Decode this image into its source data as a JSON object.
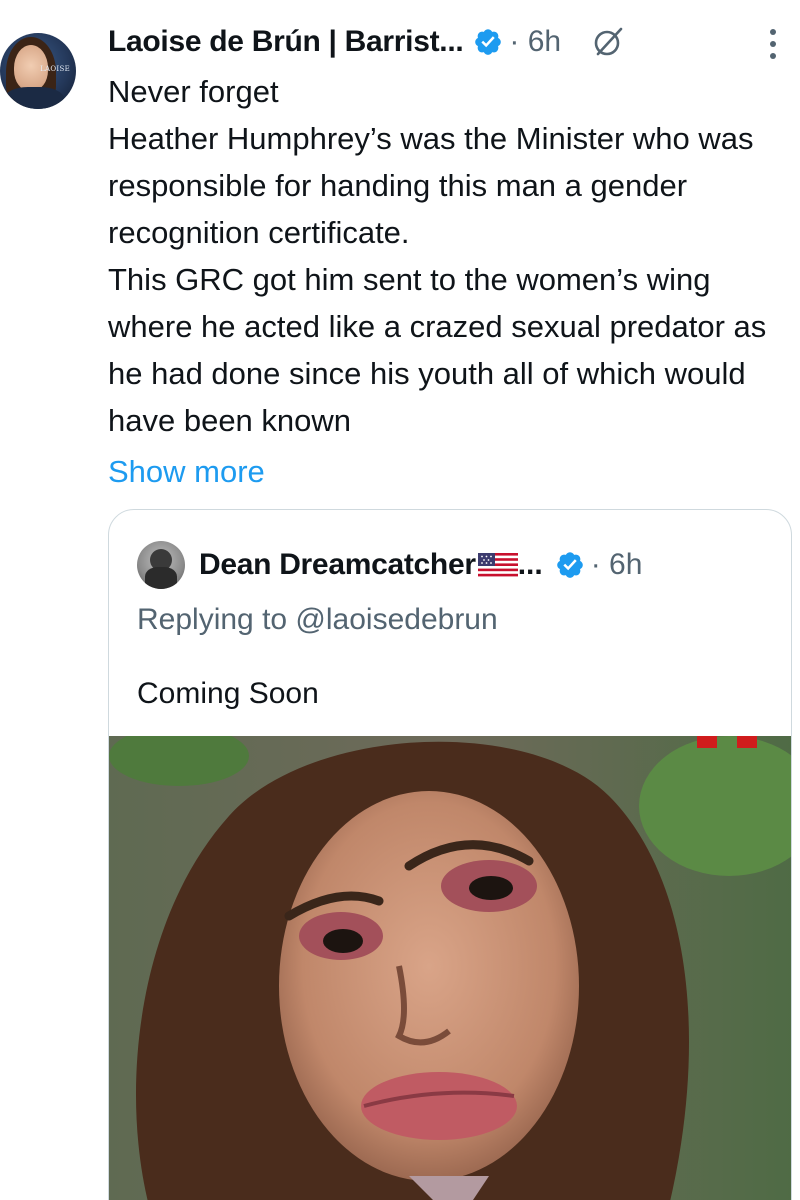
{
  "tweet": {
    "author_name": "Laoise de Brún | Barrist...",
    "time": "· 6h",
    "avatar_text": "LAOISE",
    "text": "Never forget\nHeather Humphrey’s was the Minister who was responsible for handing this man a gender recognition certificate.\n This GRC got him sent to the women’s wing where he acted like a crazed sexual predator as he had done since his youth all of which would have been known",
    "show_more": "Show more"
  },
  "quote": {
    "author_name": "Dean Dreamcatcher",
    "ellipsis": "...",
    "time": "· 6h",
    "replying_to": "Replying to @laoisedebrun",
    "text": "Coming Soon"
  },
  "icons": {
    "verified": "verified-check-icon",
    "grok": "grok-icon",
    "more": "more-vertical-icon",
    "flag": "us-flag-icon"
  },
  "colors": {
    "link": "#1d9bf0",
    "secondary_text": "#536471",
    "verified": "#1d9bf0",
    "border": "#cfd9de"
  }
}
